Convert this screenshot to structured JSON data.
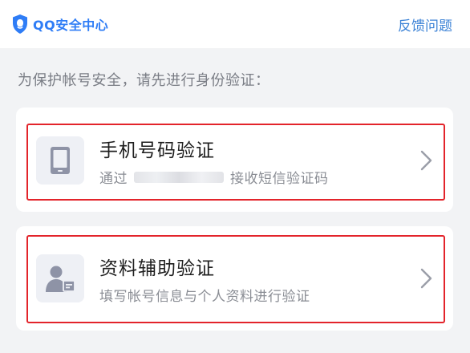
{
  "header": {
    "brand_name": "QQ安全中心",
    "brand_color": "#2f7df6",
    "feedback_label": "反馈问题"
  },
  "prompt": "为保护帐号安全，请先进行身份验证：",
  "options": [
    {
      "icon": "phone-icon",
      "title": "手机号码验证",
      "desc_prefix": "通过",
      "desc_suffix": "接收短信验证码",
      "highlighted": true
    },
    {
      "icon": "user-id-card-icon",
      "title": "资料辅助验证",
      "desc": "填写帐号信息与个人资料进行验证",
      "highlighted": true
    }
  ],
  "colors": {
    "highlight": "#e3242b",
    "link": "#3b82d6",
    "background": "#f2f3f5"
  }
}
